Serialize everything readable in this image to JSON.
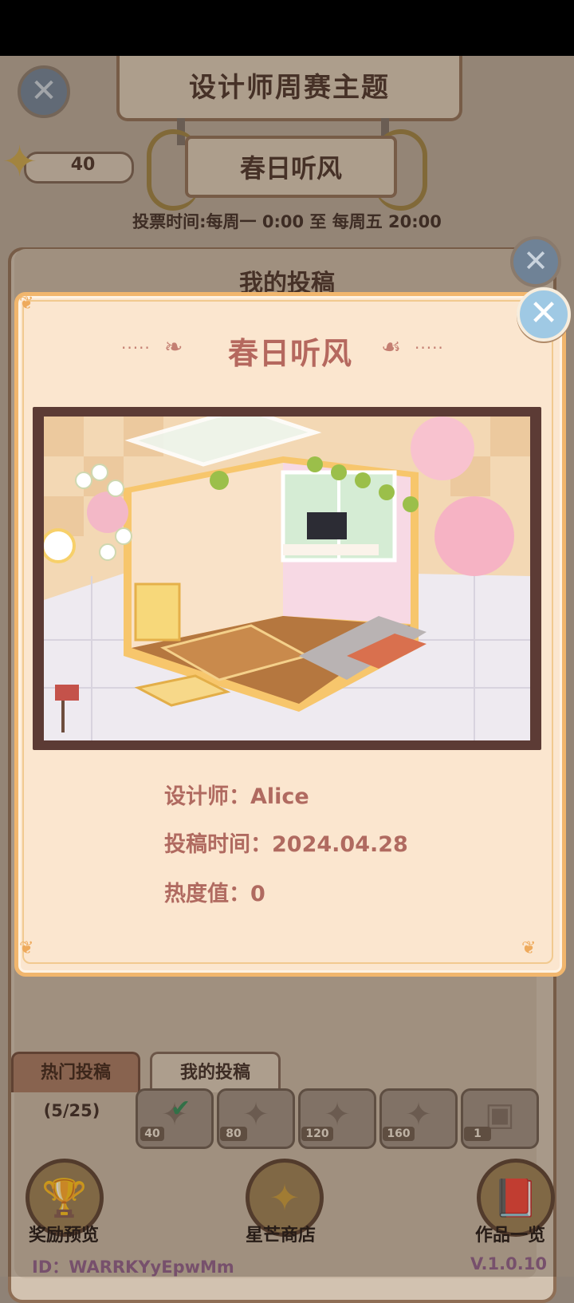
{
  "header": {
    "title": "设计师周赛主题",
    "theme": "春日听风",
    "vote_time": "投票时间:每周一  0:00  至  每周五  20:00",
    "star_count": "40"
  },
  "panel": {
    "subtitle": "我的投稿"
  },
  "modal": {
    "title": "春日听风",
    "designer_label": "设计师：",
    "designer": "Alice",
    "submit_time_label": "投稿时间：",
    "submit_time": "2024.04.28",
    "heat_label": "热度值：",
    "heat": "0"
  },
  "tabs": {
    "hot": "热门投稿",
    "mine": "我的投稿"
  },
  "progress": {
    "label": "(5/25)",
    "rewards": [
      "40",
      "80",
      "120",
      "160",
      "1"
    ]
  },
  "bottom_buttons": {
    "reward_preview": "奖励预览",
    "star_shop": "星芒商店",
    "works_list": "作品一览"
  },
  "footer": {
    "id": "ID：WARRKYyEpwMm",
    "version": "V.1.0.10"
  },
  "icons": {
    "close": "close-icon",
    "star": "star-icon",
    "check": "check-icon"
  },
  "colors": {
    "modal_bg": "#fbe6cf",
    "modal_border": "#f1b66d",
    "title_text": "#b5685e",
    "close_button": "#9fc9e4"
  }
}
